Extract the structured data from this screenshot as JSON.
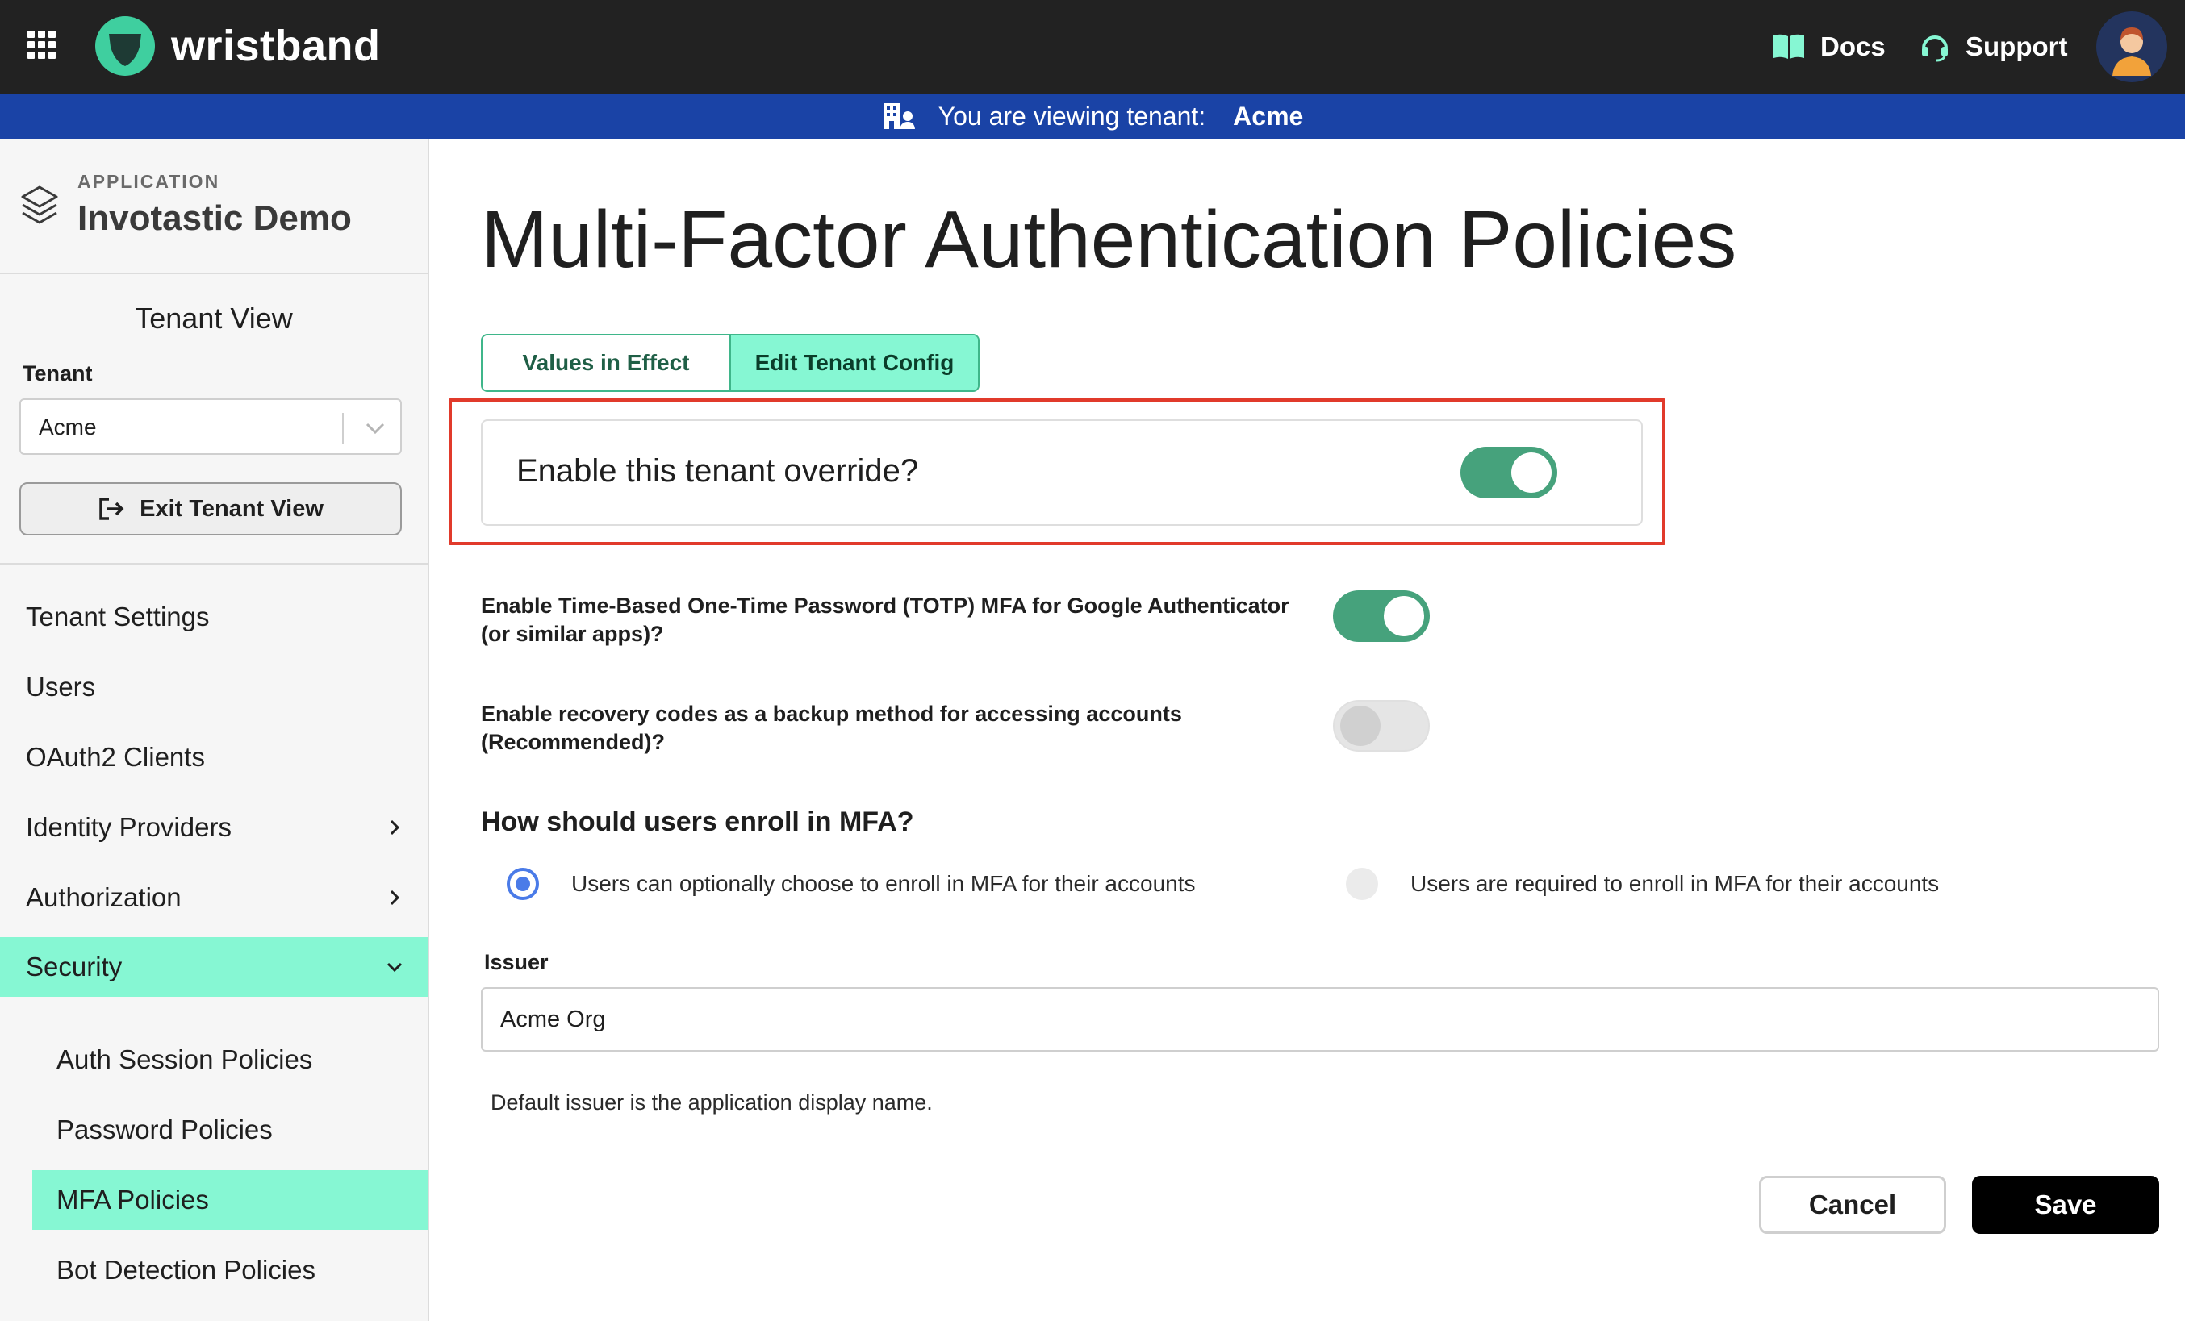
{
  "brand": {
    "name": "wristband",
    "accent": "#86f7d3",
    "toggle_on": "#46a27c",
    "banner": "#1a43a6"
  },
  "header": {
    "docs_label": "Docs",
    "support_label": "Support"
  },
  "banner": {
    "text": "You are viewing tenant:",
    "tenant": "Acme"
  },
  "sidebar": {
    "app_label": "APPLICATION",
    "app_name": "Invotastic Demo",
    "tenant_view_title": "Tenant View",
    "tenant_label": "Tenant",
    "tenant_value": "Acme",
    "exit_label": "Exit Tenant View",
    "items": [
      {
        "label": "Tenant Settings"
      },
      {
        "label": "Users"
      },
      {
        "label": "OAuth2 Clients"
      },
      {
        "label": "Identity Providers"
      },
      {
        "label": "Authorization"
      },
      {
        "label": "Security"
      }
    ],
    "security_items": [
      {
        "label": "Auth Session Policies"
      },
      {
        "label": "Password Policies"
      },
      {
        "label": "MFA Policies"
      },
      {
        "label": "Bot Detection Policies"
      }
    ]
  },
  "main": {
    "title": "Multi-Factor Authentication Policies",
    "tabs": [
      {
        "label": "Values in Effect"
      },
      {
        "label": "Edit Tenant Config"
      }
    ],
    "override_label": "Enable this tenant override?",
    "override_enabled": true,
    "totp_label": "Enable Time-Based One-Time Password (TOTP) MFA for Google Authenticator (or similar apps)?",
    "totp_enabled": true,
    "recovery_label": "Enable recovery codes as a backup method for accessing accounts (Recommended)?",
    "recovery_enabled": false,
    "enroll_title": "How should users enroll in MFA?",
    "enroll_options": [
      {
        "label": "Users can optionally choose to enroll in MFA for their accounts",
        "selected": true
      },
      {
        "label": "Users are required to enroll in MFA for their accounts",
        "selected": false
      }
    ],
    "issuer_label": "Issuer",
    "issuer_value": "Acme Org",
    "issuer_help": "Default issuer is the application display name.",
    "cancel_label": "Cancel",
    "save_label": "Save"
  }
}
